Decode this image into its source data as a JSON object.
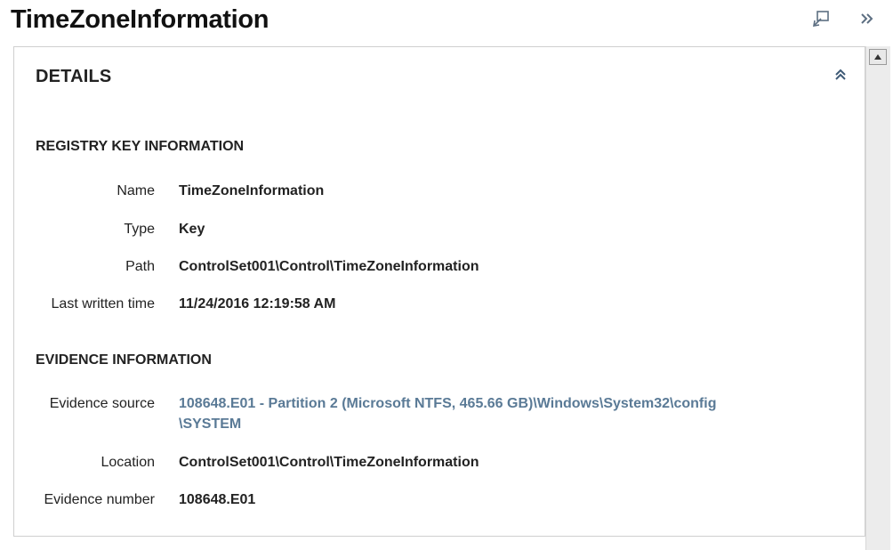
{
  "header": {
    "title": "TimeZoneInformation"
  },
  "panel": {
    "heading": "DETAILS",
    "registry": {
      "section_title": "REGISTRY KEY INFORMATION",
      "rows": [
        {
          "label": "Name",
          "value": "TimeZoneInformation"
        },
        {
          "label": "Type",
          "value": "Key"
        },
        {
          "label": "Path",
          "value": "ControlSet001\\Control\\TimeZoneInformation"
        },
        {
          "label": "Last written time",
          "value": "11/24/2016 12:19:58 AM"
        }
      ]
    },
    "evidence": {
      "section_title": "EVIDENCE INFORMATION",
      "source_label": "Evidence source",
      "source_line1": "108648.E01 - Partition 2 (Microsoft NTFS, 465.66 GB)\\Windows\\System32\\config",
      "source_line2": "\\SYSTEM",
      "location_label": "Location",
      "location_value": "ControlSet001\\Control\\TimeZoneInformation",
      "number_label": "Evidence number",
      "number_value": "108648.E01"
    }
  },
  "colors": {
    "link": "#5a7a96",
    "border": "#cfcfcf",
    "text": "#222222"
  },
  "icons": {
    "restore": "restore-window-icon",
    "more": "double-chevron-right-icon",
    "collapse": "double-chevron-up-icon",
    "scroll_up": "scroll-up-arrow-icon"
  }
}
